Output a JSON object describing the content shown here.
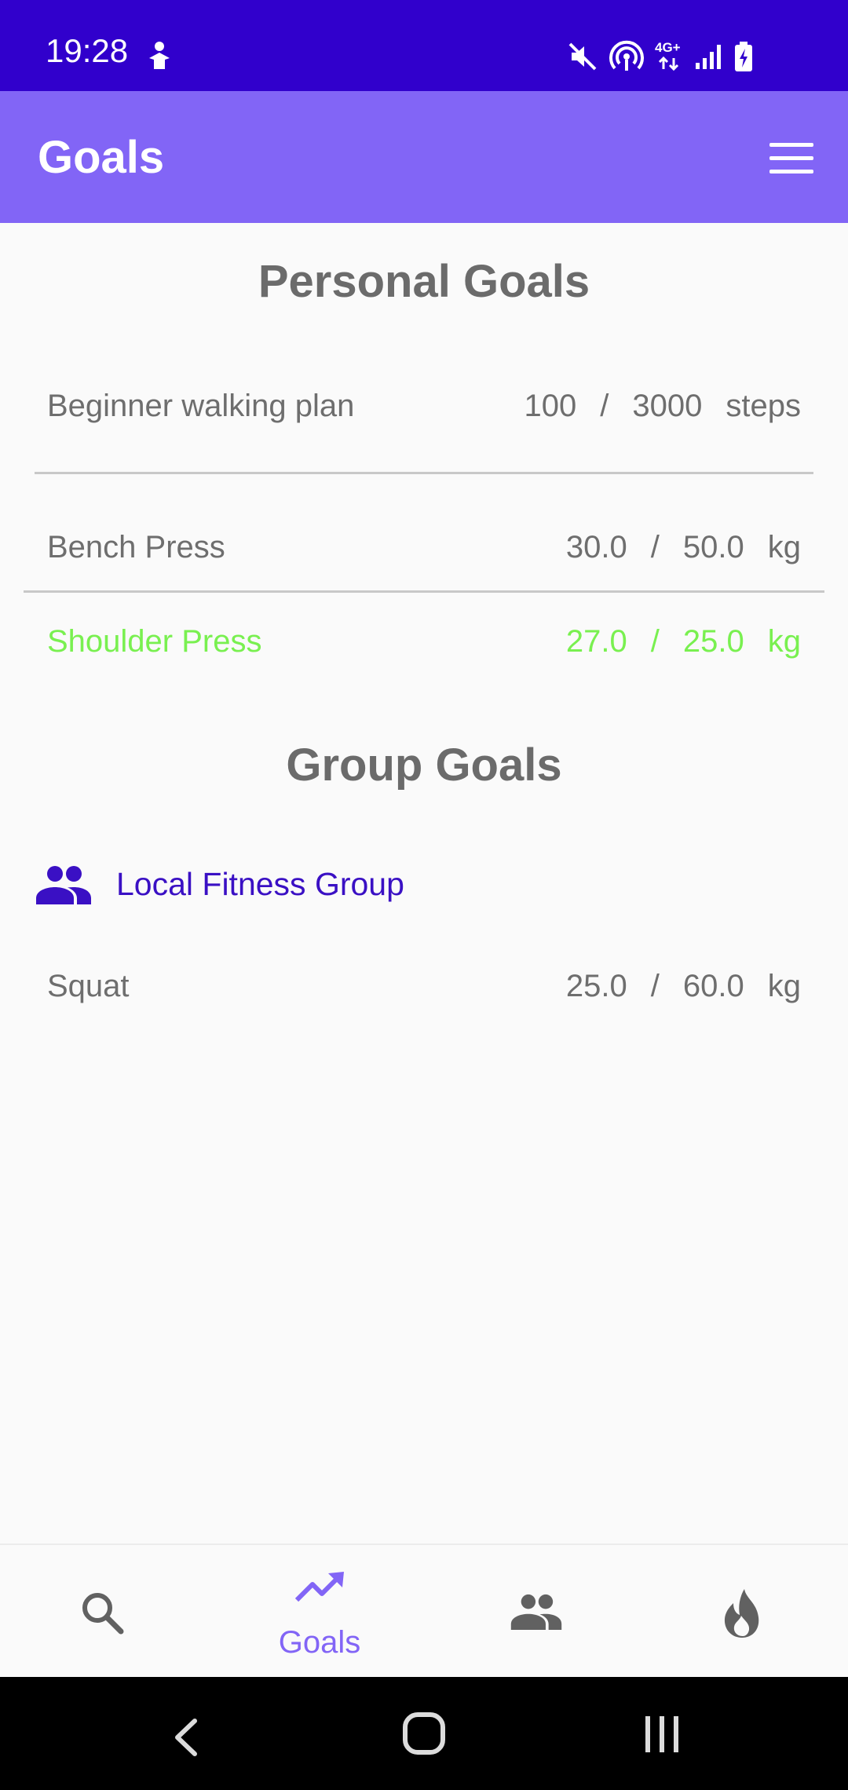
{
  "status_bar": {
    "time": "19:28",
    "left_icon": "figure-notification-icon",
    "icons": [
      "mute-icon",
      "hotspot-icon",
      "network-4g-icon",
      "signal-icon",
      "battery-charging-icon"
    ],
    "network_label": "4G+",
    "background": "#3100cc"
  },
  "app_bar": {
    "title": "Goals",
    "menu_icon": "hamburger-menu-icon",
    "background": "#8265f6"
  },
  "personal": {
    "title": "Personal Goals",
    "goals": [
      {
        "name": "Beginner walking plan",
        "current": "100",
        "separator": "/",
        "target": "3000",
        "unit": "steps"
      },
      {
        "name": "Bench Press",
        "current": "30.0",
        "separator": "/",
        "target": "50.0",
        "unit": "kg"
      },
      {
        "name": "Shoulder Press",
        "current": "27.0",
        "separator": "/",
        "target": "25.0",
        "unit": "kg",
        "completed_color": "#79f050"
      }
    ]
  },
  "group": {
    "title": "Group Goals",
    "icon": "group-people-icon",
    "group_name": "Local Fitness Group",
    "goals": [
      {
        "name": "Squat",
        "current": "25.0",
        "separator": "/",
        "target": "60.0",
        "unit": "kg"
      }
    ]
  },
  "bottom_nav": {
    "items": [
      {
        "icon": "search-icon",
        "label": ""
      },
      {
        "icon": "trending-up-icon",
        "label": "Goals",
        "active": true
      },
      {
        "icon": "group-icon",
        "label": ""
      },
      {
        "icon": "flame-icon",
        "label": ""
      }
    ],
    "active_color": "#8265f6"
  },
  "system_nav": {
    "icons": [
      "back-icon",
      "home-icon",
      "recents-icon"
    ]
  }
}
